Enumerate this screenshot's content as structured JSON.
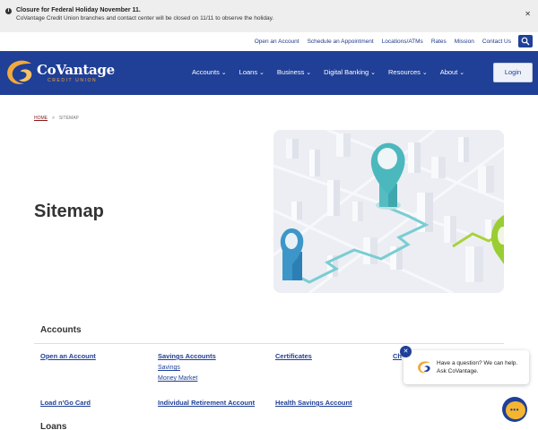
{
  "alert": {
    "title": "Closure for Federal Holiday November 11.",
    "message": "CoVantage Credit Union branches and contact center will be closed on 11/11 to observe the holiday.",
    "close": "✕"
  },
  "utility_nav": [
    "Open an Account",
    "Schedule an Appointment",
    "Locations/ATMs",
    "Rates",
    "Mission",
    "Contact Us"
  ],
  "brand": {
    "name": "CoVantage",
    "tagline": "CREDIT UNION"
  },
  "main_nav": [
    "Accounts",
    "Loans",
    "Business",
    "Digital Banking",
    "Resources",
    "About"
  ],
  "login_label": "Login",
  "breadcrumb": {
    "home": "HOME",
    "separator": ">",
    "current": "SITEMAP"
  },
  "page_title": "Sitemap",
  "sitemap": {
    "accounts_title": "Accounts",
    "open_account": "Open an Account",
    "savings_accounts": "Savings Accounts",
    "savings": "Savings",
    "money_market": "Money Market",
    "certificates": "Certificates",
    "checking_partial": "Ch",
    "load_n_go": "Load n'Go Card",
    "ira": "Individual Retirement Account",
    "hsa": "Health Savings Account",
    "loans_title": "Loans"
  },
  "chat": {
    "message": "Have a question? We can help. Ask CoVantage.",
    "close": "✕",
    "dots": "•••"
  },
  "colors": {
    "brand_blue": "#203f96",
    "accent_orange": "#f2a93b",
    "link_blue": "#1f3f98",
    "teal": "#4bb8bd",
    "green": "#9acd32"
  }
}
